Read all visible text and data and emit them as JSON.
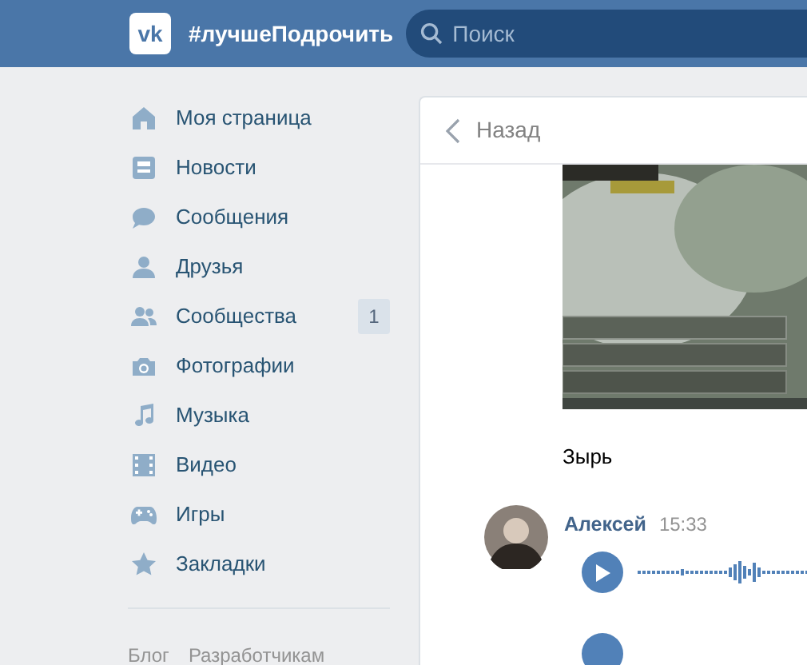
{
  "header": {
    "logo": "vk",
    "title": "#лучшеПодрочить",
    "search": {
      "placeholder": "Поиск"
    }
  },
  "sidebar": {
    "items": [
      {
        "label": "Моя страница"
      },
      {
        "label": "Новости"
      },
      {
        "label": "Сообщения"
      },
      {
        "label": "Друзья"
      },
      {
        "label": "Сообщества",
        "badge": "1"
      },
      {
        "label": "Фотографии"
      },
      {
        "label": "Музыка"
      },
      {
        "label": "Видео"
      },
      {
        "label": "Игры"
      },
      {
        "label": "Закладки"
      }
    ],
    "footer_links": [
      "Блог",
      "Разработчикам"
    ]
  },
  "conversation": {
    "back": "Назад",
    "caption": "Зырь",
    "message": {
      "author": "Алексей",
      "time": "15:33",
      "attachment": {
        "kind": "voice"
      }
    }
  }
}
